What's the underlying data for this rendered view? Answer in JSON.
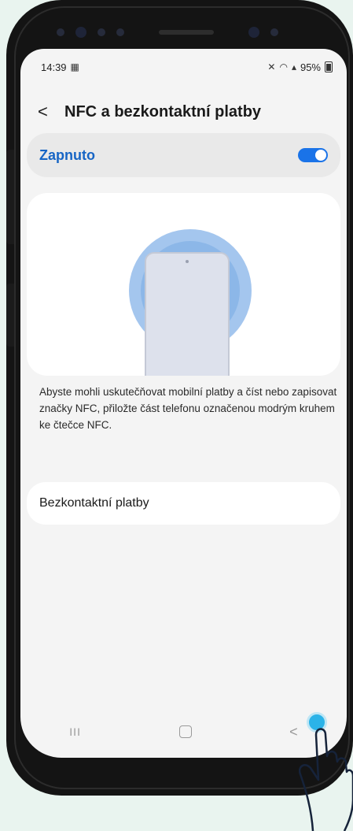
{
  "status_bar": {
    "time": "14:39",
    "battery": "95%"
  },
  "header": {
    "title": "NFC a bezkontaktní platby"
  },
  "toggle": {
    "label": "Zapnuto",
    "state": "on"
  },
  "description": "Abyste mohli uskutečňovat mobilní platby a číst nebo zapisovat značky NFC, přiložte část telefonu označenou modrým kruhem ke čtečce NFC.",
  "menu": {
    "contactless_label": "Bezkontaktní platby"
  },
  "nav": {
    "recent": "III",
    "back": "<"
  },
  "colors": {
    "accent": "#1a73e8",
    "background": "#f4f4f4",
    "tap": "#2bb3e8"
  }
}
